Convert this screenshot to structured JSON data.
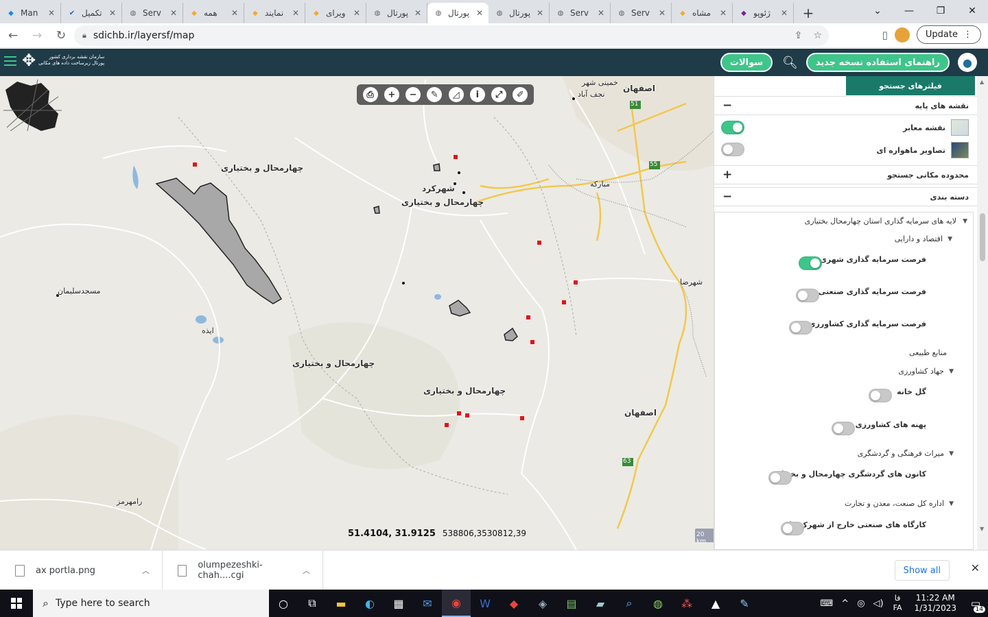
{
  "browser": {
    "tabs": [
      {
        "title": "Man",
        "fav_color": "#1e88e5",
        "fav_glyph": "◆"
      },
      {
        "title": "تکمیل",
        "fav_color": "#1565c0",
        "fav_glyph": "✔"
      },
      {
        "title": "Serv",
        "fav_color": "#5f6368",
        "fav_glyph": "◍"
      },
      {
        "title": "همه",
        "fav_color": "#f9a825",
        "fav_glyph": "◆"
      },
      {
        "title": "نمایند",
        "fav_color": "#f9a825",
        "fav_glyph": "◆"
      },
      {
        "title": "ویرای",
        "fav_color": "#f9a825",
        "fav_glyph": "◆"
      },
      {
        "title": "پورتال",
        "fav_color": "#5f6368",
        "fav_glyph": "◍"
      },
      {
        "title": "پورتال",
        "fav_color": "#5f6368",
        "fav_glyph": "◍",
        "active": true
      },
      {
        "title": "پورتال",
        "fav_color": "#5f6368",
        "fav_glyph": "◍"
      },
      {
        "title": "Serv",
        "fav_color": "#5f6368",
        "fav_glyph": "◍"
      },
      {
        "title": "Serv",
        "fav_color": "#5f6368",
        "fav_glyph": "◍"
      },
      {
        "title": "مشاه",
        "fav_color": "#f9a825",
        "fav_glyph": "◆"
      },
      {
        "title": "ژئوپو",
        "fav_color": "#7b1fa2",
        "fav_glyph": "◆"
      }
    ],
    "url": "sdichb.ir/layersf/map",
    "update_label": "Update"
  },
  "header": {
    "logo_line1": "سازمان نقشه برداری کشور",
    "logo_line2": "پورتال زیرساخت داده های مکانی",
    "guide_button": "راهنمای استفاده نسخه جدید",
    "faq_button": "سوالات"
  },
  "map": {
    "labels": {
      "khomeini_shahr": "خمینی شهر",
      "najafabad": "نجف آباد",
      "isfahan_top": "اصفهان",
      "chb_north": "چهارمحال و بختیاری",
      "shahrekord": "شهرکرد",
      "chb_center": "چهارمحال و بختیاری",
      "mobarakeh": "مبارکه",
      "masjed_soleyman": "مسجدسلیمان",
      "shahreza": "شهرضا",
      "izeh": "ایذه",
      "chb_west": "چهارمحال و بختیاری",
      "chb_south": "چهارمحال و بختیاری",
      "isfahan_south": "اصفهان",
      "ramhormoz": "رامهرمز",
      "road_51": "51",
      "road_55": "55",
      "road_63": "63"
    },
    "coords_geo": "51.4104, 31.9125",
    "coords_utm": "538806,3530812,39",
    "scale": "20 km",
    "toolbar": [
      "print-icon",
      "zoom-in-icon",
      "zoom-out-icon",
      "draw-line-icon",
      "measure-area-icon",
      "info-icon",
      "fullscreen-icon",
      "brush-icon"
    ]
  },
  "panel": {
    "tab_label": "فیلترهای جستجو",
    "base_maps": {
      "title": "نقشه های پایه",
      "items": [
        {
          "label": "نقشه معابر",
          "on": true
        },
        {
          "label": "تصاویر ماهواره ای",
          "on": false
        }
      ]
    },
    "spatial_extent": "محدوده مکانی جستجو",
    "categories": "دسته بندی",
    "tree": {
      "root": "لایه های سرمایه گذاری استان چهارمحال بختیاری",
      "economy": "اقتصاد و دارایی",
      "urban": "فرصت سرمایه گذاری شهری",
      "industrial": "فرصت سرمایه گذاری صنعتی",
      "agricultural": "فرصت سرمایه گذاری کشاورزی",
      "natural": "منابع طبیعی",
      "jahad": "جهاد کشاورزی",
      "greenhouse": "گل خانه",
      "farm_zones": "پهنه های کشاورزی",
      "heritage": "میراث فرهنگی و گردشگری",
      "tourism": "کانون های گردشگری چهارمحال و بختیاری",
      "industry_dept": "اداره کل صنعت، معدن و تجارت",
      "workshops": "کارگاه های صنعتی خارج از شهرک ها"
    }
  },
  "downloads": {
    "items": [
      {
        "name": "ax portla.png"
      },
      {
        "name": "olumpezeshki-chah....cgi"
      }
    ],
    "show_all": "Show all"
  },
  "taskbar": {
    "search_placeholder": "Type here to search",
    "lang_top": "فا",
    "lang_bottom": "FA",
    "time": "11:22 AM",
    "date": "1/31/2023",
    "notifications": "14"
  }
}
